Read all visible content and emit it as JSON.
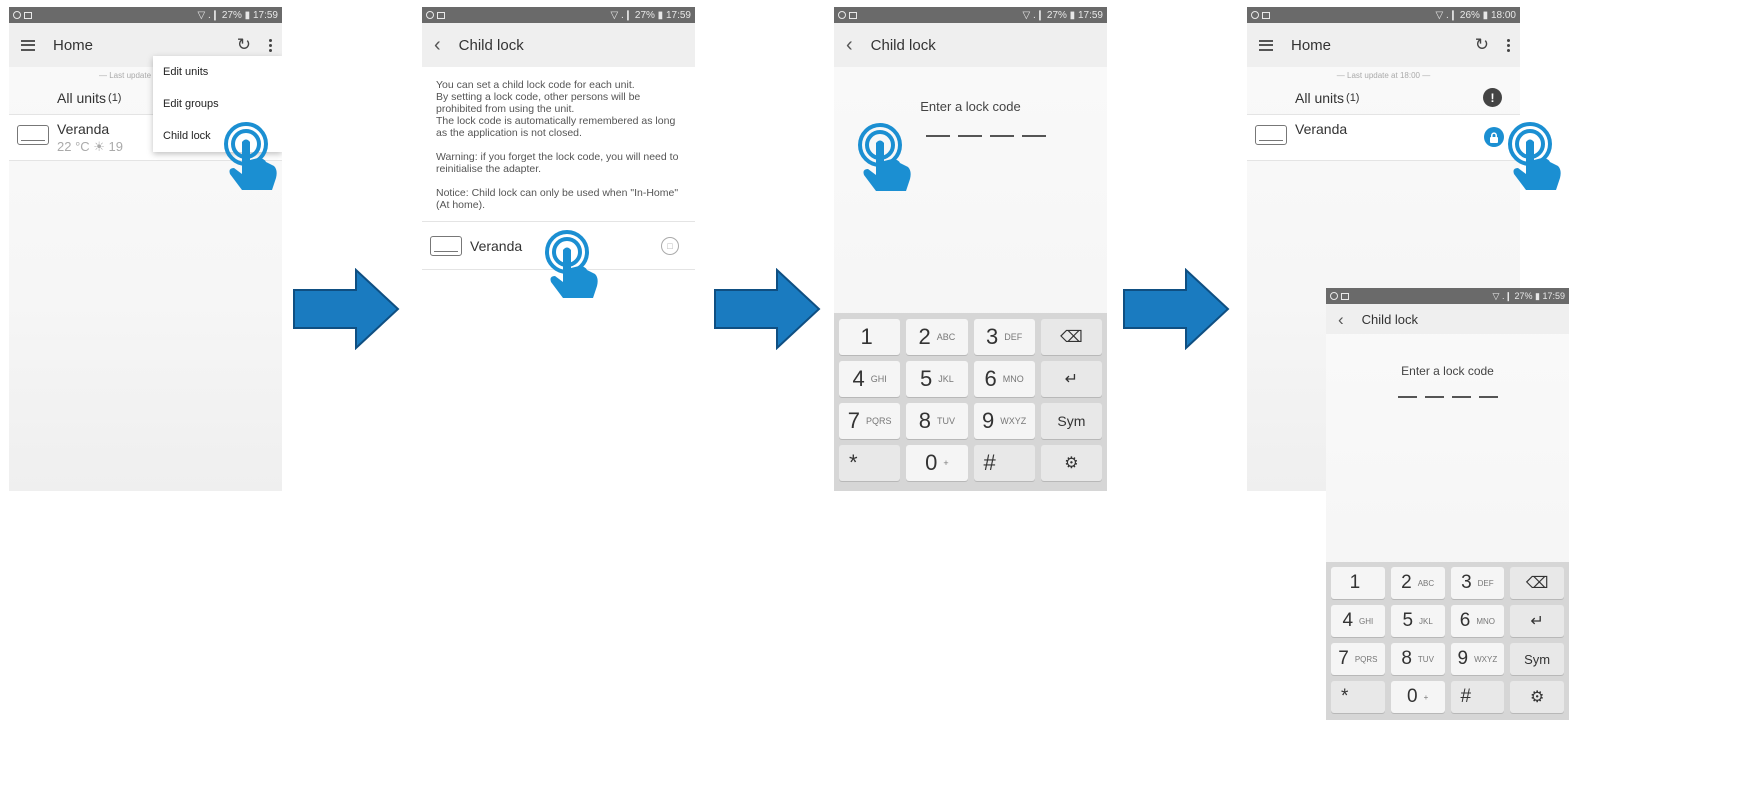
{
  "status_bars": [
    {
      "right": "▽ .❙ 27% ▮ 17:59"
    },
    {
      "right": "▽ .❙ 27% ▮ 17:59"
    },
    {
      "right": "▽ .❙ 27% ▮ 17:59"
    },
    {
      "right": "▽ .❙ 26% ▮ 18:00"
    },
    {
      "right": "▽ .❙ 27% ▮ 17:59"
    }
  ],
  "screen1": {
    "title": "Home",
    "last_update": "— Last update",
    "all_units": "All units",
    "all_units_count": "(1)",
    "unit_name": "Veranda",
    "unit_status": "22 °C ☀ 19",
    "menu": [
      "Edit units",
      "Edit groups",
      "Child lock"
    ]
  },
  "screen2": {
    "title": "Child lock",
    "paragraphs": [
      "You can set a child lock code for each unit.\nBy setting a lock code, other persons will be prohibited from using the unit.\nThe lock code is automatically remembered as long as the application is not closed.",
      "Warning: if you forget the lock code, you will need to reinitialise the adapter.",
      "Notice: Child lock can only be used when \"In-Home\" (At home)."
    ],
    "unit_name": "Veranda"
  },
  "screen3": {
    "title": "Child lock",
    "prompt": "Enter a lock code"
  },
  "screen4": {
    "title": "Home",
    "last_update": "— Last update at 18:00 —",
    "all_units": "All units",
    "all_units_count": "(1)",
    "unit_name": "Veranda"
  },
  "screen5": {
    "title": "Child lock",
    "prompt": "Enter a lock code"
  },
  "keyboard": [
    {
      "digit": "1",
      "letters": ""
    },
    {
      "digit": "2",
      "letters": "ABC"
    },
    {
      "digit": "3",
      "letters": "DEF"
    },
    {
      "fn": "backspace"
    },
    {
      "digit": "4",
      "letters": "GHI"
    },
    {
      "digit": "5",
      "letters": "JKL"
    },
    {
      "digit": "6",
      "letters": "MNO"
    },
    {
      "fn": "enter"
    },
    {
      "digit": "7",
      "letters": "PQRS"
    },
    {
      "digit": "8",
      "letters": "TUV"
    },
    {
      "digit": "9",
      "letters": "WXYZ"
    },
    {
      "label": "Sym"
    },
    {
      "label": "*"
    },
    {
      "digit": "0",
      "letters": "+"
    },
    {
      "label": "#"
    },
    {
      "fn": "settings"
    }
  ],
  "colors": {
    "accent_blue": "#1b8fd2",
    "arrow_blue": "#1a7bc0",
    "arrow_border": "#0f4f82"
  }
}
